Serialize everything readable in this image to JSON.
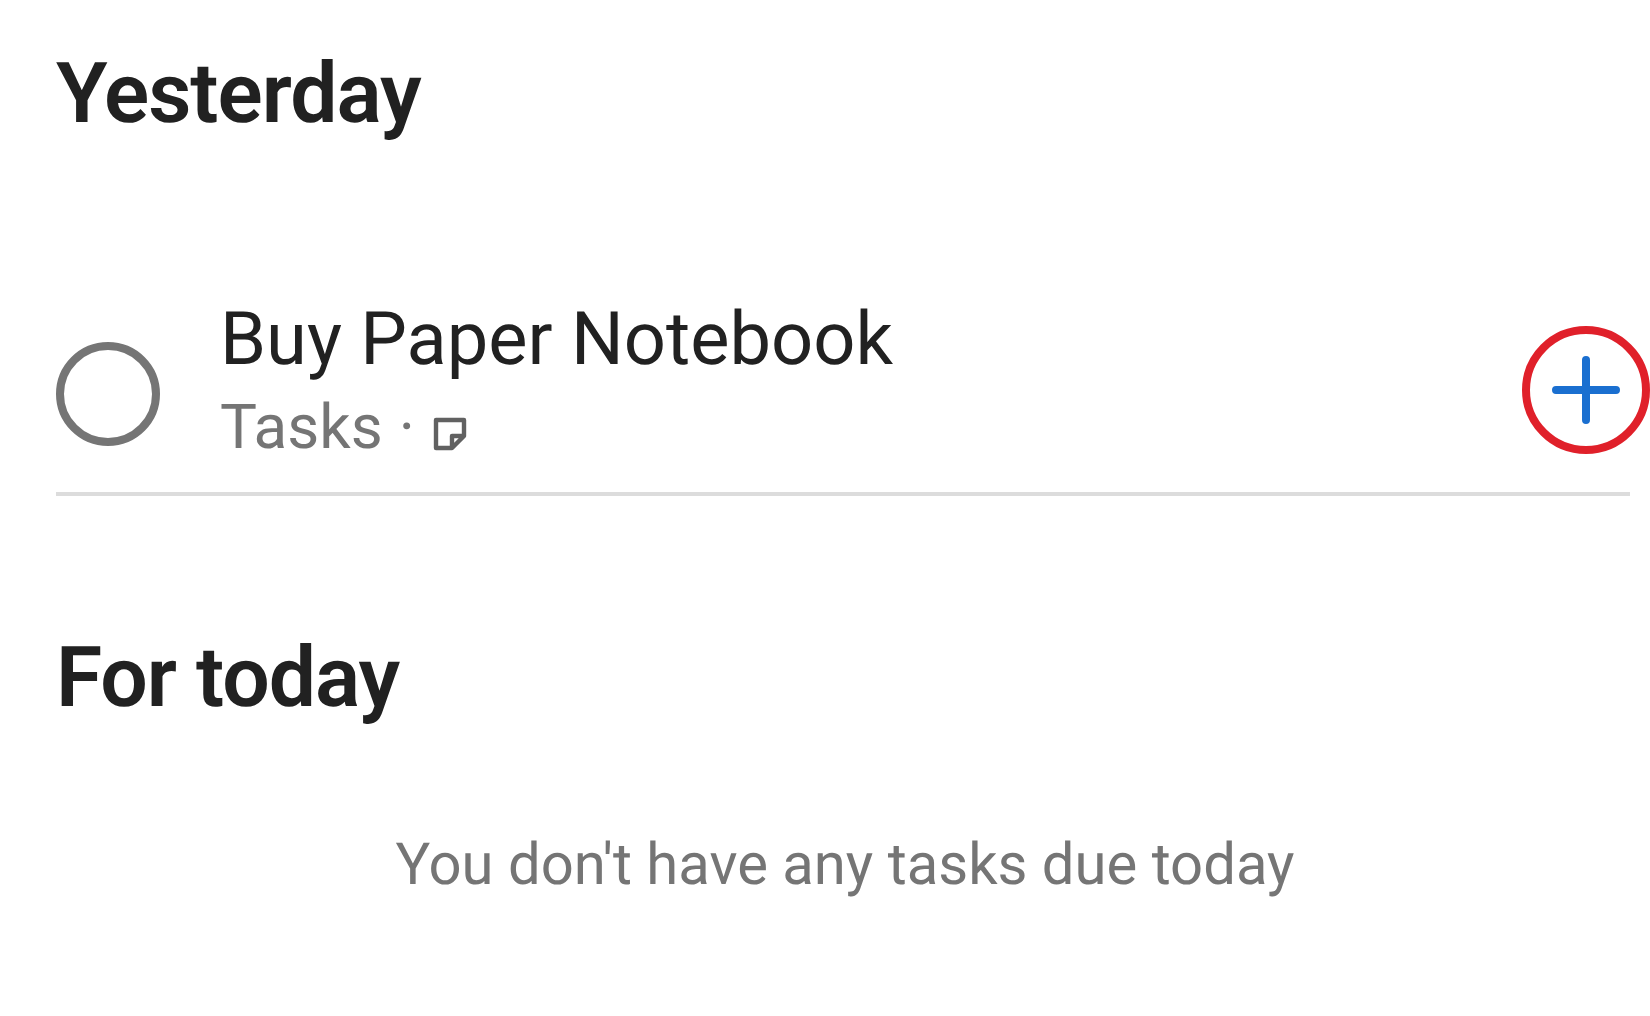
{
  "sections": [
    {
      "heading": "Yesterday",
      "tasks": [
        {
          "title": "Buy Paper Notebook",
          "list": "Tasks",
          "separator": "·",
          "has_note": true,
          "completed": false,
          "add_highlighted": true
        }
      ]
    },
    {
      "heading": "For today",
      "empty_message": "You don't have any tasks due today"
    }
  ]
}
